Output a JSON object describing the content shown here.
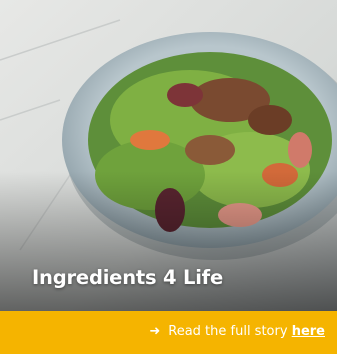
{
  "promo": {
    "title": "Ingredients 4 Life",
    "link": {
      "arrow_icon": "arrow-right-icon",
      "text": "Read the full story ",
      "link_word": "here"
    },
    "colors": {
      "bar": "#f5b400",
      "text": "#ffffff"
    },
    "image": {
      "subject": "salad-bowl-photo"
    }
  }
}
